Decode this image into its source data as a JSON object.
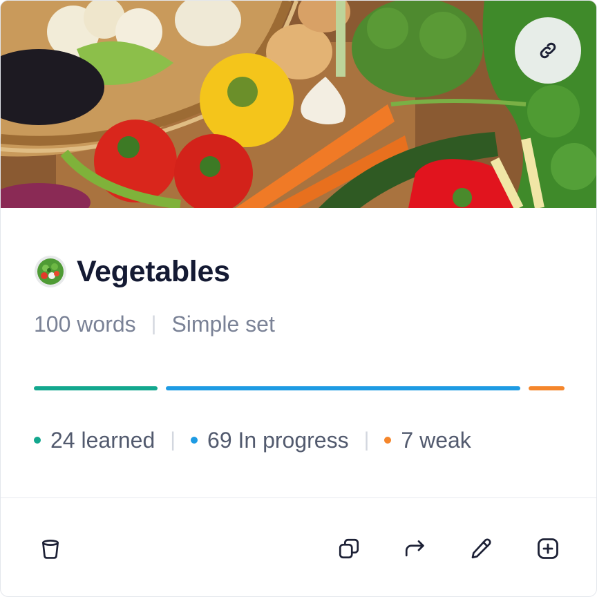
{
  "card": {
    "title": "Vegetables",
    "word_count": "100 words",
    "set_type": "Simple set",
    "image_icon": "vegetables-photo",
    "title_icon": "salad-bowl-icon"
  },
  "progress": {
    "learned": {
      "count": 24,
      "label": "24 learned",
      "color": "#13a78e"
    },
    "in_progress": {
      "count": 69,
      "label": "69 In progress",
      "color": "#1e9be3"
    },
    "weak": {
      "count": 7,
      "label": "7 weak",
      "color": "#f5862b"
    },
    "total": 100
  },
  "actions": {
    "top": [
      "link-icon"
    ],
    "bottom_left": [
      "trash-icon"
    ],
    "bottom_right": [
      "copy-icon",
      "share-icon",
      "pencil-icon",
      "add-square-icon"
    ]
  },
  "colors": {
    "title": "#141a33",
    "meta": "#7a8296",
    "stats": "#525a6e",
    "icon": "#1c2035"
  }
}
